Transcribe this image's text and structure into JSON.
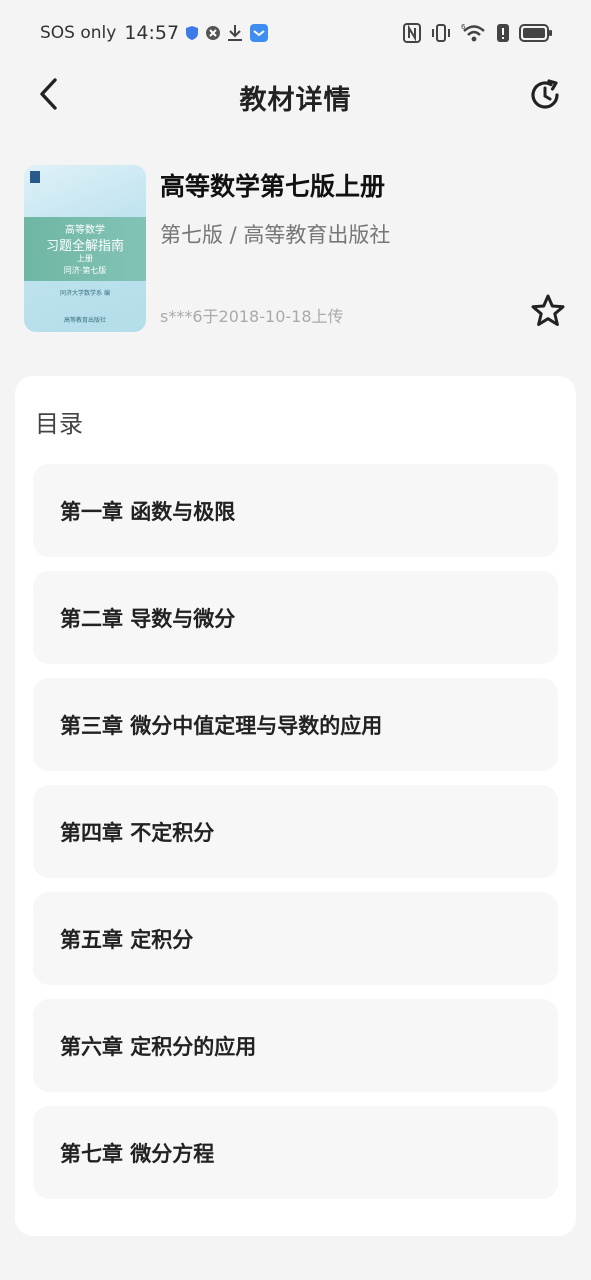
{
  "status_bar": {
    "carrier": "SOS only",
    "time": "14:57",
    "network_sup": "6"
  },
  "nav": {
    "title": "教材详情",
    "back_icon": "chevron-left-icon",
    "refresh_icon": "refresh-icon"
  },
  "book": {
    "title": "高等数学第七版上册",
    "subtitle": "第七版 / 高等教育出版社",
    "upload_info": "s***6于2018-10-18上传",
    "favorite_icon": "star-outline-icon",
    "cover": {
      "line1": "高等数学",
      "line2": "习题全解指南",
      "line3": "上册",
      "line4": "同济·第七版",
      "line5": "同济大学数学系 编",
      "publisher_mark": "高等教育出版社",
      "colors": {
        "top": "#dff1f8",
        "band": "#6fb6a4"
      }
    }
  },
  "toc": {
    "heading": "目录",
    "chapters": [
      {
        "label": "第一章 函数与极限"
      },
      {
        "label": "第二章 导数与微分"
      },
      {
        "label": "第三章 微分中值定理与导数的应用"
      },
      {
        "label": "第四章 不定积分"
      },
      {
        "label": "第五章 定积分"
      },
      {
        "label": "第六章 定积分的应用"
      },
      {
        "label": "第七章 微分方程"
      }
    ]
  },
  "colors": {
    "background": "#f4f4f4",
    "card": "#ffffff",
    "item_bg": "#f7f7f7",
    "text_primary": "#222222",
    "text_secondary": "#777777",
    "text_muted": "#aaaaaa"
  }
}
